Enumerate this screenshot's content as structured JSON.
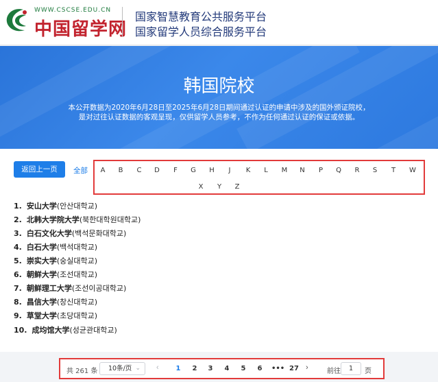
{
  "header": {
    "brand_url": "WWW.CSCSE.EDU.CN",
    "brand_name": "中国留学网",
    "platform_line_1": "国家智慧教育公共服务平台",
    "platform_line_2": "国家留学人员综合服务平台"
  },
  "banner": {
    "title": "韩国院校",
    "desc_line_1": "本公开数据为2020年6月28日至2025年6月28日期间通过认证的申请中涉及的国外颁证院校，",
    "desc_line_2": "是对过往认证数据的客观呈现，仅供留学人员参考，不作为任何通过认证的保证或依据。"
  },
  "toolbar": {
    "back_label": "返回上一页",
    "all_label": "全部"
  },
  "letters_row_1": [
    "A",
    "B",
    "C",
    "D",
    "F",
    "G",
    "H",
    "J",
    "K",
    "L",
    "M",
    "N",
    "P",
    "Q",
    "R",
    "S",
    "T",
    "W"
  ],
  "letters_row_2": [
    "X",
    "Y",
    "Z"
  ],
  "universities": [
    {
      "num": "1.",
      "cn": "安山大学",
      "ko": "(안산대학교)"
    },
    {
      "num": "2.",
      "cn": "北韩大学院大学",
      "ko": "(북한대학원대학교)"
    },
    {
      "num": "3.",
      "cn": "白石文化大学",
      "ko": "(백석문화대학교)"
    },
    {
      "num": "4.",
      "cn": "白石大学",
      "ko": "(백석대학교)"
    },
    {
      "num": "5.",
      "cn": "崇实大学",
      "ko": "(숭실대학교)"
    },
    {
      "num": "6.",
      "cn": "朝鲜大学",
      "ko": "(조선대학교)"
    },
    {
      "num": "7.",
      "cn": "朝鲜理工大学",
      "ko": "(조선이공대학교)"
    },
    {
      "num": "8.",
      "cn": "昌信大学",
      "ko": "(창신대학교)"
    },
    {
      "num": "9.",
      "cn": "草堂大学",
      "ko": "(초당대학교)"
    },
    {
      "num": "10.",
      "cn": "成均馆大学",
      "ko": "(성균관대학교)"
    }
  ],
  "pagination": {
    "total": "共 261 条",
    "page_size": "10条/页",
    "pages": [
      "1",
      "2",
      "3",
      "4",
      "5",
      "6",
      "•••",
      "27"
    ],
    "current_page": "1",
    "goto_label": "前往",
    "goto_value": "1",
    "page_suffix": "页"
  },
  "colors": {
    "accent": "#1e7ee8",
    "highlight_border": "#e23a3a",
    "brand_red": "#c2232e",
    "brand_green": "#1d7a3c"
  }
}
